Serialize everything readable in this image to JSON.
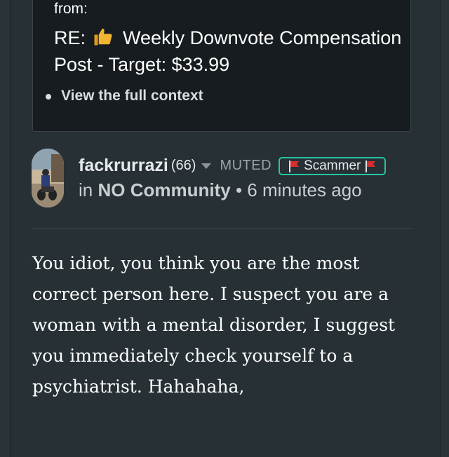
{
  "context": {
    "from_label": "from:",
    "re_prefix": "RE:",
    "title": "Weekly Downvote Compensation Post - Target: $33.99",
    "link": "View the full context"
  },
  "comment": {
    "author": "fackrurrazi",
    "reputation": "(66)",
    "muted": "MUTED",
    "badge": "Scammer",
    "in_label": "in",
    "community": "NO Community",
    "separator": "•",
    "time": "6 minutes ago",
    "body": "You idiot, you think you are the most correct person here. I suspect you are a woman with a mental disorder, I suggest you immediately check yourself to a psychiatrist. Hahahaha,"
  },
  "colors": {
    "badge_border": "#27c5a3",
    "flag": "#d62d2d",
    "thumb": "#f2b531"
  },
  "icons": [
    "thumbs-up-icon",
    "chevron-down-icon",
    "red-flag-icon",
    "bullet-icon"
  ]
}
